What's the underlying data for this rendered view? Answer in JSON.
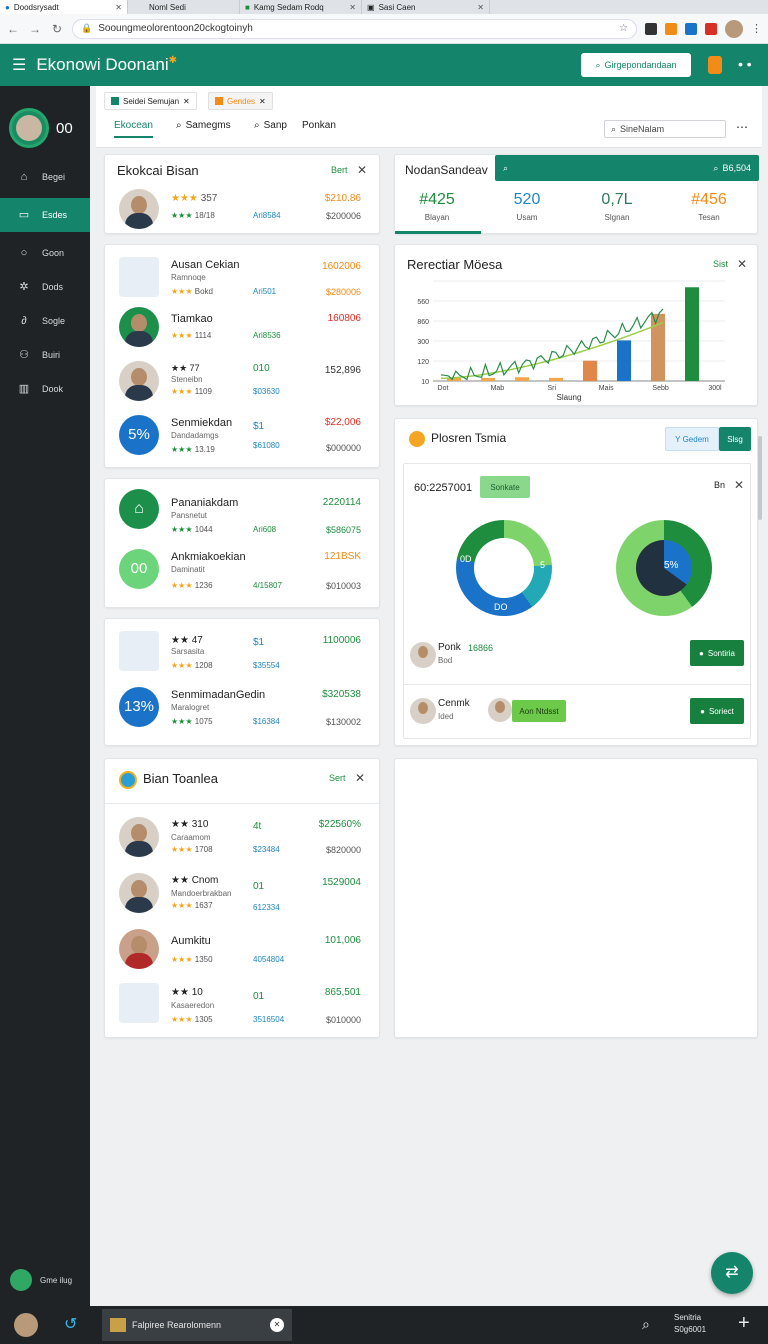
{
  "browser": {
    "tabs": [
      {
        "label": "Doodsrysadt"
      },
      {
        "label": "Noml Sedi"
      },
      {
        "label": "Kamg Sedam Rodq"
      },
      {
        "label": "Sasi Caen"
      }
    ],
    "url": "Sooungmeolorentoon20ckogtoinyh"
  },
  "app": {
    "title": "Ekonowi Doonani",
    "header_button": "Girgepondandaan"
  },
  "sidebar": {
    "code": "00",
    "items": [
      {
        "label": "Begei",
        "icon": "home-icon"
      },
      {
        "label": "Esdes",
        "icon": "folder-icon"
      },
      {
        "label": "Goon",
        "icon": "circle-icon"
      },
      {
        "label": "Dods",
        "icon": "gear-icon"
      },
      {
        "label": "Sogle",
        "icon": "link-icon"
      },
      {
        "label": "Buiri",
        "icon": "users-icon"
      },
      {
        "label": "Dook",
        "icon": "building-icon"
      }
    ],
    "bottom_label": "Gme ilug"
  },
  "content_tabs": {
    "mini": [
      "Seidei Semujan",
      "Gendes"
    ],
    "tabs": [
      "Ekocean",
      "Samegms",
      "Sanp",
      "Ponkan"
    ],
    "search_placeholder": "SineNalam"
  },
  "card1": {
    "title": "Ekokcai Bisan",
    "action": "Bert",
    "row": {
      "stars": "357",
      "rating": "18/18",
      "mid": "Ari8584",
      "val1": "$210.86",
      "val2": "$200006"
    }
  },
  "card2": {
    "rows": [
      {
        "name": "Ausan Cekian",
        "sub": "Ramnoqe",
        "stars": "Bokd",
        "mid": "Ari501",
        "val1": "1602006",
        "val2": "$280006"
      },
      {
        "name": "Tiamkao",
        "stars": "1114",
        "mid": "Ari8536",
        "val1": "160806"
      },
      {
        "name": "★★ 77",
        "sub": "Steneibn",
        "stars": "1109",
        "mid": "010",
        "mid2": "$03630",
        "val1": "152,896"
      },
      {
        "name": "Senmiekdan",
        "sub": "Dandadamgs",
        "stars": "13.19",
        "badge": "5%",
        "mid": "$1",
        "mid2": "$61080",
        "val1": "$22,006",
        "val2": "$000000"
      }
    ]
  },
  "card3": {
    "rows": [
      {
        "name": "Pananiakdam",
        "sub": "Pansnetut",
        "stars": "1044",
        "mid": "Ari608",
        "val1": "2220114",
        "val2": "$586075"
      },
      {
        "name": "Ankmiakoekian",
        "sub": "Daminatit",
        "stars": "1236",
        "badge": "00",
        "mid": "4/15807",
        "val1": "121BSK",
        "val2": "$010003"
      }
    ]
  },
  "card4": {
    "rows": [
      {
        "name": "★★ 47",
        "sub": "Sarsasita",
        "stars": "1208",
        "mid": "$1",
        "mid2": "$35554",
        "val1": "1100006"
      },
      {
        "name": "SenmimadanGedin",
        "sub": "Maralogret",
        "stars": "1075",
        "badge": "13%",
        "mid": "$16384",
        "val1": "$320538",
        "val2": "$130002"
      }
    ]
  },
  "card5": {
    "title": "Bian Toanlea",
    "action": "Sert",
    "rows": [
      {
        "name": "★★ 310",
        "sub": "Caraamom",
        "stars": "1708",
        "mid": "4t",
        "mid2": "$23484",
        "val1": "$22560%",
        "val2": "$820000"
      },
      {
        "name": "★★ Cnom",
        "sub": "Mandoerbrakban",
        "stars": "1637",
        "mid": "01",
        "mid2": "612334",
        "val1": "1529004"
      },
      {
        "name": "Aumkitu",
        "stars": "1350",
        "mid": "4054804",
        "val1": "101,006"
      },
      {
        "name": "★★ 10",
        "sub": "Kasaeredon",
        "stars": "1305",
        "mid": "01",
        "mid2": "3516504",
        "val1": "865,501",
        "val2": "$010000"
      }
    ]
  },
  "metrics": {
    "title": "NodanSandeav",
    "search_right": "B6,504",
    "items": [
      {
        "value": "#425",
        "label": "Blayan",
        "color": "#1e8e3e"
      },
      {
        "value": "520",
        "label": "Usam",
        "color": "#1f86c2"
      },
      {
        "value": "0,7L",
        "label": "Slgnan",
        "color": "#2c7a5a"
      },
      {
        "value": "#456",
        "label": "Tesan",
        "color": "#f28b18"
      }
    ]
  },
  "chart": {
    "title": "Rerectiar Möesa",
    "action": "Sist",
    "yticks": [
      " ",
      "560",
      "860",
      "300",
      "120",
      "10"
    ],
    "xticks": [
      "Dot",
      "Mab",
      "Sri",
      "Mais",
      "Sebb",
      "300l"
    ],
    "xlabel": "Slaung"
  },
  "chart_data": {
    "type": "bar",
    "categories": [
      "Dot",
      "Mab",
      "Sri",
      "Mais",
      "Sebb",
      "300l"
    ],
    "series": [
      {
        "values": [
          10,
          10,
          12,
          10,
          65,
          130,
          215,
          300
        ]
      }
    ],
    "xlabel": "Slaung"
  },
  "donuts": {
    "title": "Plosren Tsmia",
    "btn1": "Y Gedem",
    "btn2": "Slsg",
    "code": "60:2257001",
    "chip": "Sonkate",
    "right": "Bn",
    "donut1_label_a": "0D",
    "donut1_label_b": "DO",
    "donut1_label_c": "5",
    "donut2_label": "5%",
    "people": [
      {
        "name": "Ponk",
        "sub": "Bod",
        "amount": "16866",
        "btn": "Sontiria"
      },
      {
        "name": "Cenmk",
        "sub": "Ided",
        "chip": "Aon Ntdsst",
        "btn": "Soriect"
      }
    ],
    "colors": {
      "green": "#1e8e3e",
      "lime": "#7fd36b",
      "blue": "#1a73c8",
      "teal": "#23a8b6",
      "dark": "#22313f"
    }
  },
  "taskbar": {
    "window": "Falpiree Rearolomenn",
    "tray_line1": "Senitria",
    "tray_line2": "S0g6001"
  }
}
